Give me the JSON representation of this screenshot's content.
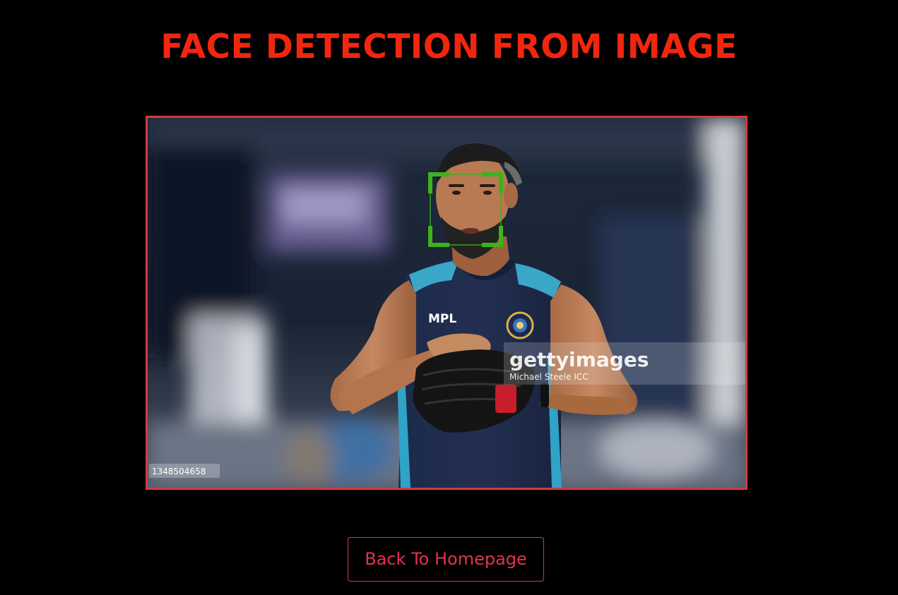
{
  "page": {
    "title": "FACE DETECTION FROM IMAGE"
  },
  "photo": {
    "watermark_brand": "gettyimages",
    "watermark_credit": "Michael Steele ICC",
    "image_id": "1348504658",
    "jersey_text": "MPL",
    "detection_count": 1
  },
  "actions": {
    "back_label": "Back To Homepage"
  },
  "colors": {
    "title": "#f2260f",
    "frame_border": "#d63a3e",
    "detection_box": "#3fb21a",
    "button": "#e0344a",
    "background": "#000000"
  }
}
